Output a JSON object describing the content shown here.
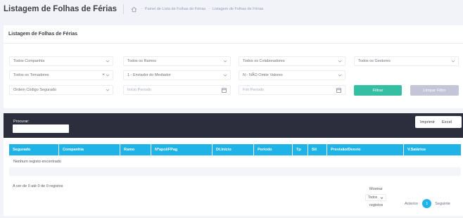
{
  "header": {
    "title": "Listagem de Folhas de Férias",
    "breadcrumbs": [
      "Painel de Lista de Folhas de Férias",
      "Listagem de Folhas de Férias"
    ]
  },
  "filters_card": {
    "title": "Listagem de Folhas de Férias",
    "row1": [
      "Todos Companhia",
      "Todos os Ramos",
      "Todos os Colaboradores",
      "Todos os Gestores"
    ],
    "row2": [
      "Todos os Tomadores",
      "1 - Enviador do Mediador",
      "N - NÃO Omite Valores"
    ],
    "row3": {
      "order": "Ordem Código Segurado",
      "start_placeholder": "Início Período",
      "end_placeholder": "Fim Período",
      "filter_button": "Filtrar",
      "clear_button": "Limpar Filtro"
    }
  },
  "toolbar": {
    "search_label": "Procurar:",
    "print_button": "Imprimir",
    "excel_button": "Excel"
  },
  "table": {
    "columns": [
      "Segurado",
      "Companhia",
      "Ramo",
      "Nºapol/FPag",
      "Dt.Início",
      "Período",
      "Tp",
      "Sit",
      "Previsão/Desvio",
      "V.Salários"
    ],
    "empty_text": "Nenhum registo encontrado",
    "info": "A ver de 0 até 0 de 0 registos",
    "show_label": "Mostrar",
    "show_value": "Todos",
    "records_label": "registos",
    "prev": "Anterior",
    "page": "1",
    "next": "Seguinte"
  },
  "colors": {
    "accent": "#1fb3e8",
    "success": "#34bfa3",
    "dark": "#2c2e3e",
    "disabled": "#c4c5d6"
  },
  "icons": [
    "home-icon",
    "chevron-down-icon",
    "clear-icon",
    "calendar-icon"
  ]
}
